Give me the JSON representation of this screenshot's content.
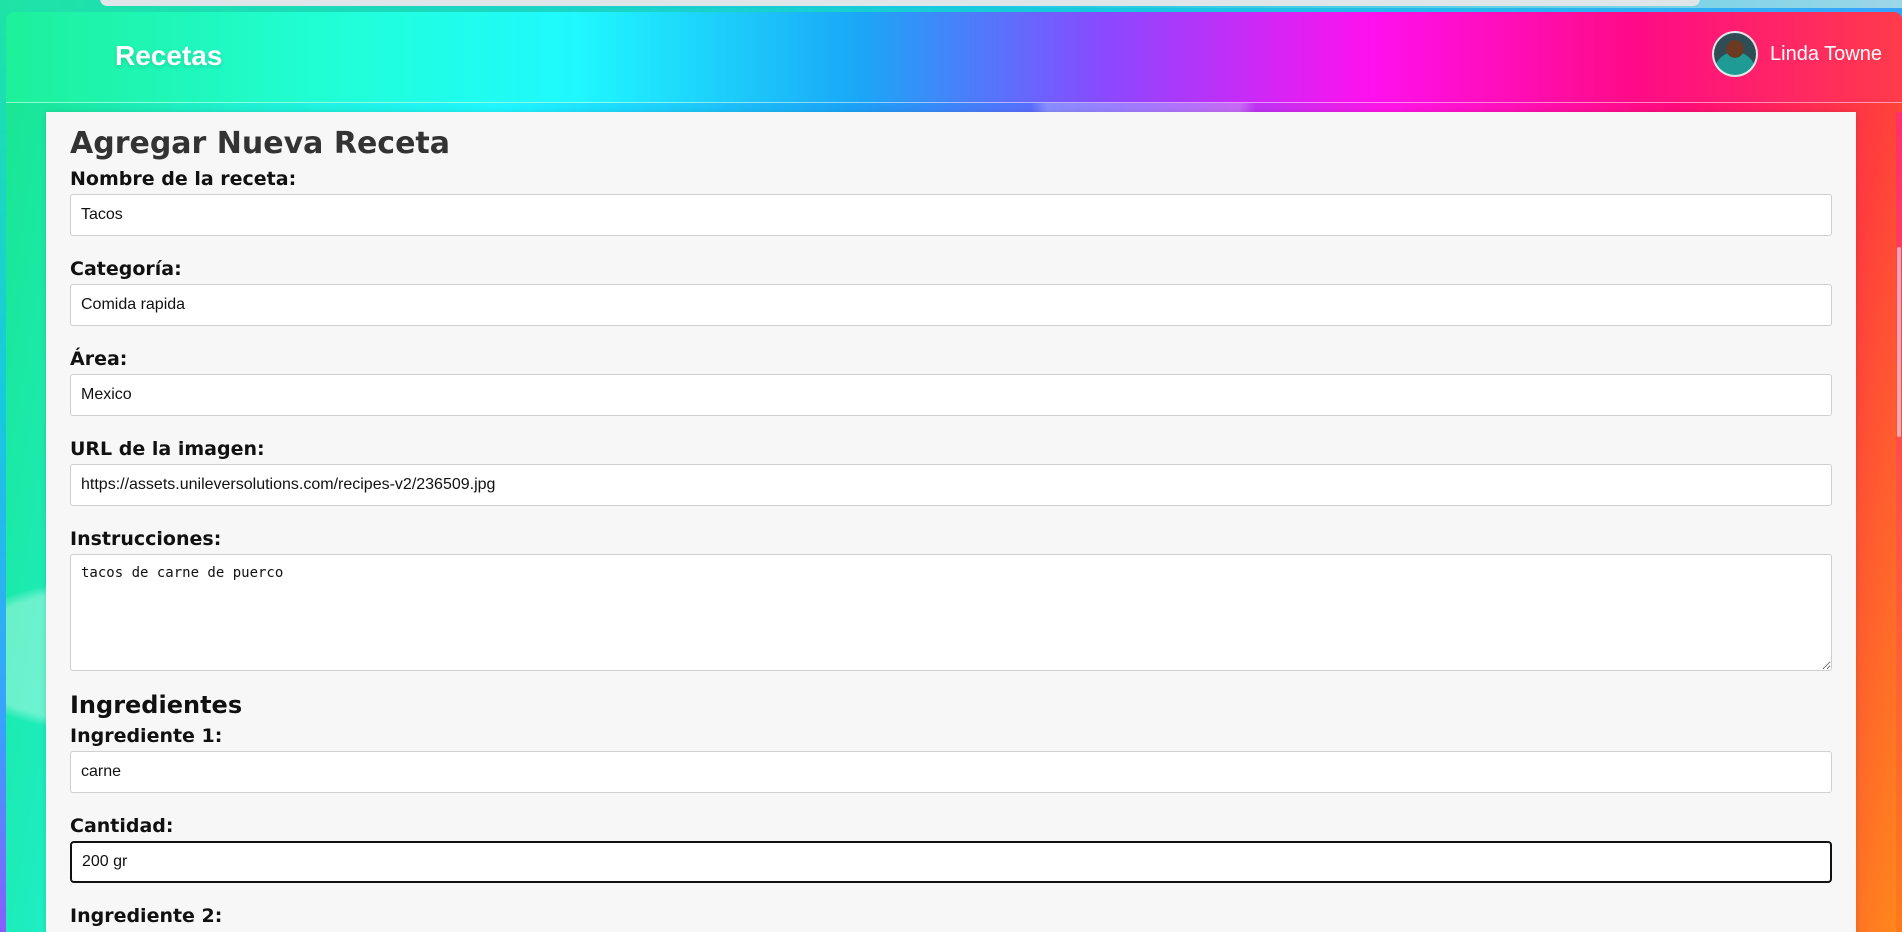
{
  "navbar": {
    "brand": "Recetas",
    "user_name": "Linda Towne"
  },
  "form": {
    "title": "Agregar Nueva Receta",
    "fields": {
      "name": {
        "label": "Nombre de la receta:",
        "value": "Tacos"
      },
      "category": {
        "label": "Categoría:",
        "value": "Comida rapida"
      },
      "area": {
        "label": "Área:",
        "value": "Mexico"
      },
      "image_url": {
        "label": "URL de la imagen:",
        "value": "https://assets.unileversolutions.com/recipes-v2/236509.jpg"
      },
      "instructions": {
        "label": "Instrucciones:",
        "value": "tacos de carne de puerco"
      }
    },
    "ingredients": {
      "heading": "Ingredientes",
      "items": [
        {
          "label": "Ingrediente 1:",
          "value": "carne",
          "quantity_label": "Cantidad:",
          "quantity_value": "200 gr"
        },
        {
          "label": "Ingrediente 2:"
        }
      ]
    }
  },
  "icons": {
    "avatar": "user-avatar"
  }
}
